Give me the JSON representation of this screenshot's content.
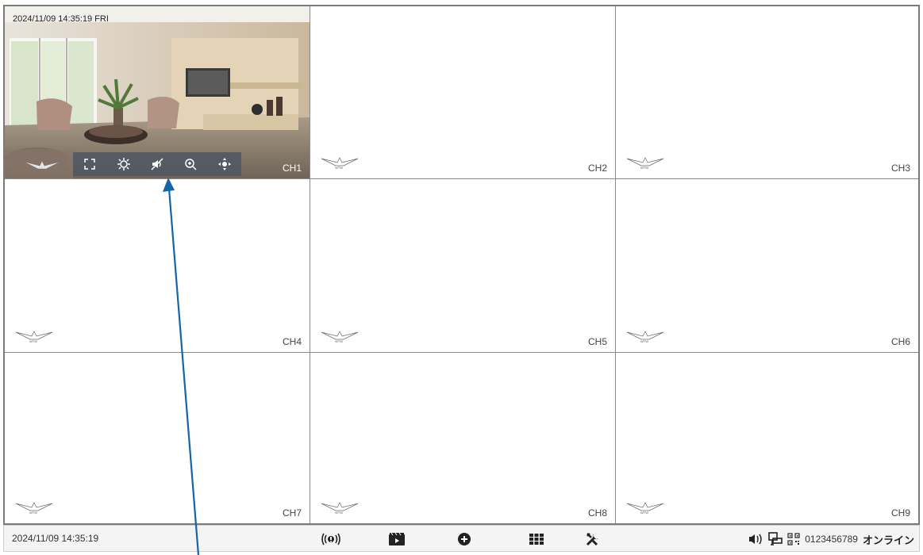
{
  "channels": [
    {
      "label": "CH1",
      "osd_time": "2024/11/09 14:35:19 FRI",
      "live": true
    },
    {
      "label": "CH2"
    },
    {
      "label": "CH3"
    },
    {
      "label": "CH4"
    },
    {
      "label": "CH5"
    },
    {
      "label": "CH6"
    },
    {
      "label": "CH7"
    },
    {
      "label": "CH8"
    },
    {
      "label": "CH9"
    }
  ],
  "ptz_controls": [
    "fullscreen-icon",
    "brightness-icon",
    "mute-icon",
    "zoom-in-icon",
    "ptz-direction-icon"
  ],
  "status_bar": {
    "time": "2024/11/09 14:35:19",
    "tools": [
      "alarm-icon",
      "playback-icon",
      "add-icon",
      "layout-grid-icon",
      "settings-tools-icon"
    ],
    "device_id": "0123456789",
    "network_status": "オンライン"
  },
  "colors": {
    "arrow": "#1565a8",
    "ptz_bar": "#505862",
    "border": "#8a8a8a"
  }
}
